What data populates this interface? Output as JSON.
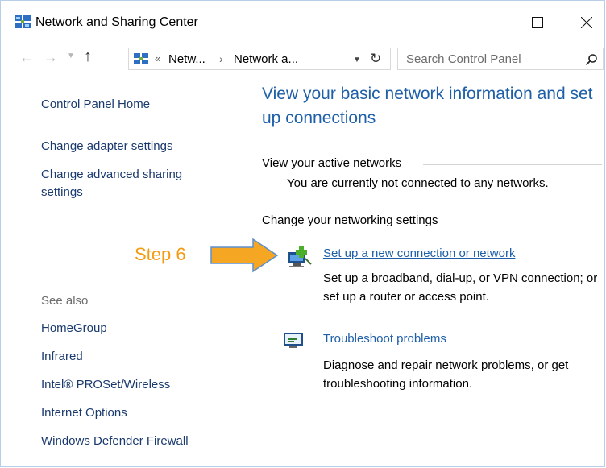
{
  "window": {
    "title": "Network and Sharing Center",
    "controls": {
      "minimize": "minimize-icon",
      "maximize": "maximize-icon",
      "close": "close-icon"
    }
  },
  "address_bar": {
    "overflow": "«",
    "crumbs": [
      "Netw...",
      "Network a..."
    ],
    "separator": "›",
    "search_placeholder": "Search Control Panel"
  },
  "left_pane": {
    "links": [
      "Control Panel Home",
      "Change adapter settings",
      "Change advanced sharing settings"
    ],
    "see_also_heading": "See also",
    "see_also": [
      "HomeGroup",
      "Infrared",
      "Intel® PROSet/Wireless",
      "Internet Options",
      "Windows Defender Firewall"
    ]
  },
  "main": {
    "heading": "View your basic network information and set up connections",
    "active_networks_label": "View your active networks",
    "active_networks_status": "You are currently not connected to any networks.",
    "change_settings_label": "Change your networking settings",
    "tasks": [
      {
        "title": "Set up a new connection or network",
        "description": "Set up a broadband, dial-up, or VPN connection; or set up a router or access point.",
        "icon": "new-connection-icon"
      },
      {
        "title": "Troubleshoot problems",
        "description": "Diagnose and repair network problems, or get troubleshooting information.",
        "icon": "troubleshoot-icon"
      }
    ]
  },
  "annotation": {
    "text": "Step 6",
    "color": "#f39c12"
  },
  "colors": {
    "link": "#1e5fa8",
    "heading": "#1e5fa8",
    "left_link": "#1a3a6e",
    "muted": "#6d6d6d",
    "accent_arrow": "#f39c12"
  }
}
